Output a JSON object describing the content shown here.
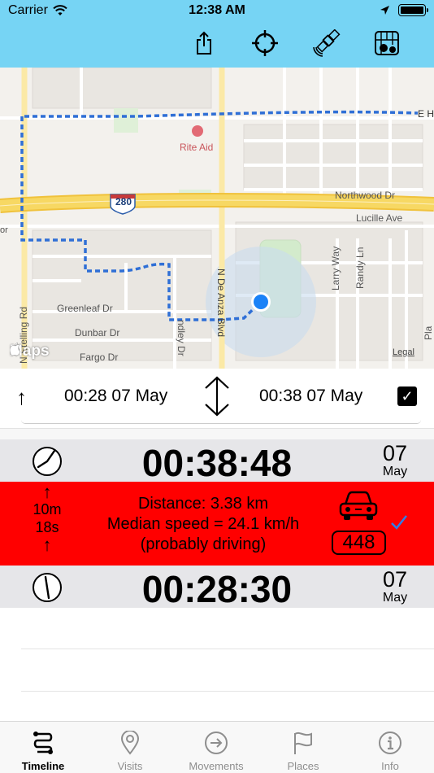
{
  "status_bar": {
    "carrier": "Carrier",
    "time": "12:38 AM"
  },
  "nav": {
    "buttons": [
      {
        "icon": "share-icon"
      },
      {
        "icon": "locate-crosshair-icon"
      },
      {
        "icon": "satellite-icon"
      },
      {
        "icon": "map-layers-icon"
      }
    ]
  },
  "map": {
    "labels": {
      "e_ho": "E Ho",
      "rite_aid": "Rite Aid",
      "i280": "280",
      "northwood": "Northwood Dr",
      "lucille": "Lucille Ave",
      "greenleaf": "Greenleaf Dr",
      "dunbar": "Dunbar Dr",
      "fargo": "Fargo Dr",
      "n_de_anza": "N De Anza Blvd",
      "larry_way": "Larry Way",
      "randy_ln": "Randy Ln",
      "n_stelling": "N Stelling Rd",
      "ndley": "ndley Dr",
      "maps_logo": "Maps",
      "legal": "Legal",
      "edge_pla": "Pla",
      "edge_or": "or"
    },
    "colors": {
      "route": "#2f6fd6",
      "user_dot": "#1a82f7",
      "highway": "#f7cf48"
    }
  },
  "selector": {
    "direction_arrow": "↑",
    "start": "00:28 07 May",
    "end": "00:38 07 May",
    "checked": true,
    "check_mark": "✓"
  },
  "timeline": {
    "end_entry": {
      "time": "00:38:48",
      "day": "07",
      "month": "May"
    },
    "movement": {
      "arrow_up": "↑",
      "duration_minutes": "10m",
      "duration_seconds": "18s",
      "arrow_up_bottom": "↑",
      "distance": "Distance: 3.38 km",
      "speed": "Median speed = 24.1 km/h",
      "mode": "(probably driving)",
      "points": "448",
      "mode_icon": "car-icon",
      "color": "#ff0000"
    },
    "start_entry": {
      "time": "00:28:30",
      "day": "07",
      "month": "May"
    }
  },
  "tabs": [
    {
      "label": "Timeline",
      "icon": "timeline-icon",
      "active": true
    },
    {
      "label": "Visits",
      "icon": "pin-icon",
      "active": false
    },
    {
      "label": "Movements",
      "icon": "arrow-circle-icon",
      "active": false
    },
    {
      "label": "Places",
      "icon": "flag-icon",
      "active": false
    },
    {
      "label": "Info",
      "icon": "info-icon",
      "active": false
    }
  ]
}
